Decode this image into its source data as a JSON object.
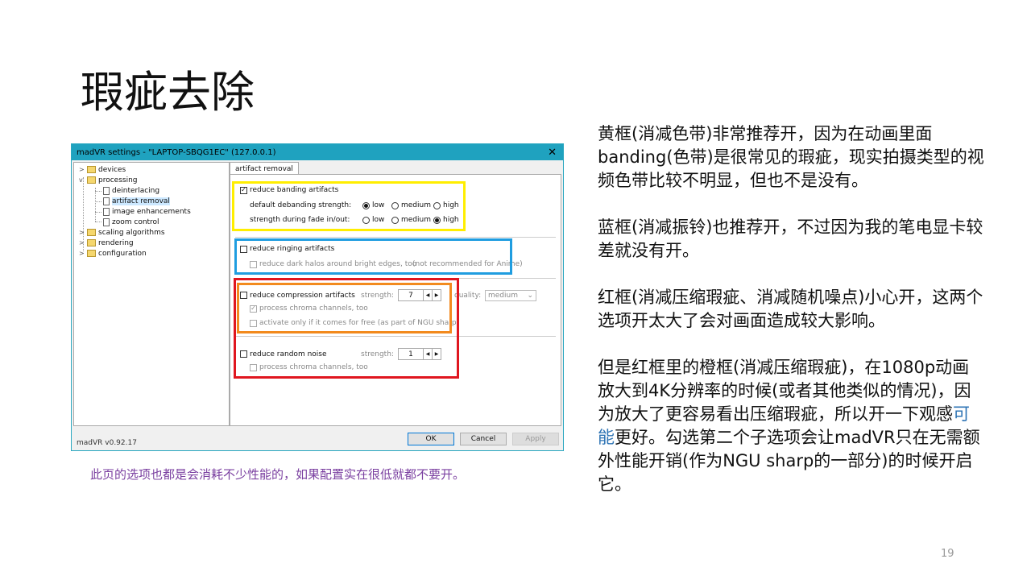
{
  "slide": {
    "title": "瑕疵去除",
    "page_number": "19",
    "bottom_note": "此页的选项也都是会消耗不少性能的，如果配置实在很低就都不要开。"
  },
  "explanation": {
    "p1": "黄框(消减色带)非常推荐开，因为在动画里面banding(色带)是很常见的瑕疵，现实拍摄类型的视频色带比较不明显，但也不是没有。",
    "p2": "蓝框(消减振铃)也推荐开，不过因为我的笔电显卡较差就没有开。",
    "p3": "红框(消减压缩瑕疵、消减随机噪点)小心开，这两个选项开太大了会对画面造成较大影响。",
    "p4_a": "但是红框里的橙框(消减压缩瑕疵)，在1080p动画放大到4K分辨率的时候(或者其他类似的情况)，因为放大了更容易看出压缩瑕疵，所以开一下观感",
    "p4_hl": "可能",
    "p4_b": "更好。勾选第二个子选项会让madVR只在无需额外性能开销(作为NGU sharp的一部分)的时候开启它。"
  },
  "dialog": {
    "title": "madVR settings - \"LAPTOP-SBQG1EC\" (127.0.0.1)",
    "close": "✕",
    "tree": {
      "devices": "devices",
      "processing": "processing",
      "deinterlacing": "deinterlacing",
      "artifact_removal": "artifact removal",
      "image_enhancements": "image enhancements",
      "zoom_control": "zoom control",
      "scaling_algorithms": "scaling algorithms",
      "rendering": "rendering",
      "configuration": "configuration"
    },
    "tab": "artifact removal",
    "banding": {
      "label": "reduce banding artifacts",
      "default_label": "default debanding strength:",
      "fade_label": "strength during fade in/out:",
      "low": "low",
      "medium": "medium",
      "high": "high",
      "default_selected": "low",
      "fade_selected": "high"
    },
    "ringing": {
      "label": "reduce ringing artifacts",
      "sub": "reduce dark halos around bright edges, too",
      "note": "(not recommended for Anime)"
    },
    "compression": {
      "label": "reduce compression artifacts",
      "strength_label": "strength:",
      "strength_value": "7",
      "quality_label": "quality:",
      "quality_value": "medium",
      "sub1": "process chroma channels, too",
      "sub2": "activate only if it comes for free (as part of NGU sharp)"
    },
    "noise": {
      "label": "reduce random noise",
      "strength_label": "strength:",
      "strength_value": "1",
      "sub": "process chroma channels, too"
    },
    "version": "madVR v0.92.17",
    "buttons": {
      "ok": "OK",
      "cancel": "Cancel",
      "apply": "Apply"
    }
  },
  "colors": {
    "yellow": "#ffee00",
    "blue": "#1f9de0",
    "red": "#e0161f",
    "orange": "#f28a1e",
    "titlebar": "#1fa2bf"
  }
}
